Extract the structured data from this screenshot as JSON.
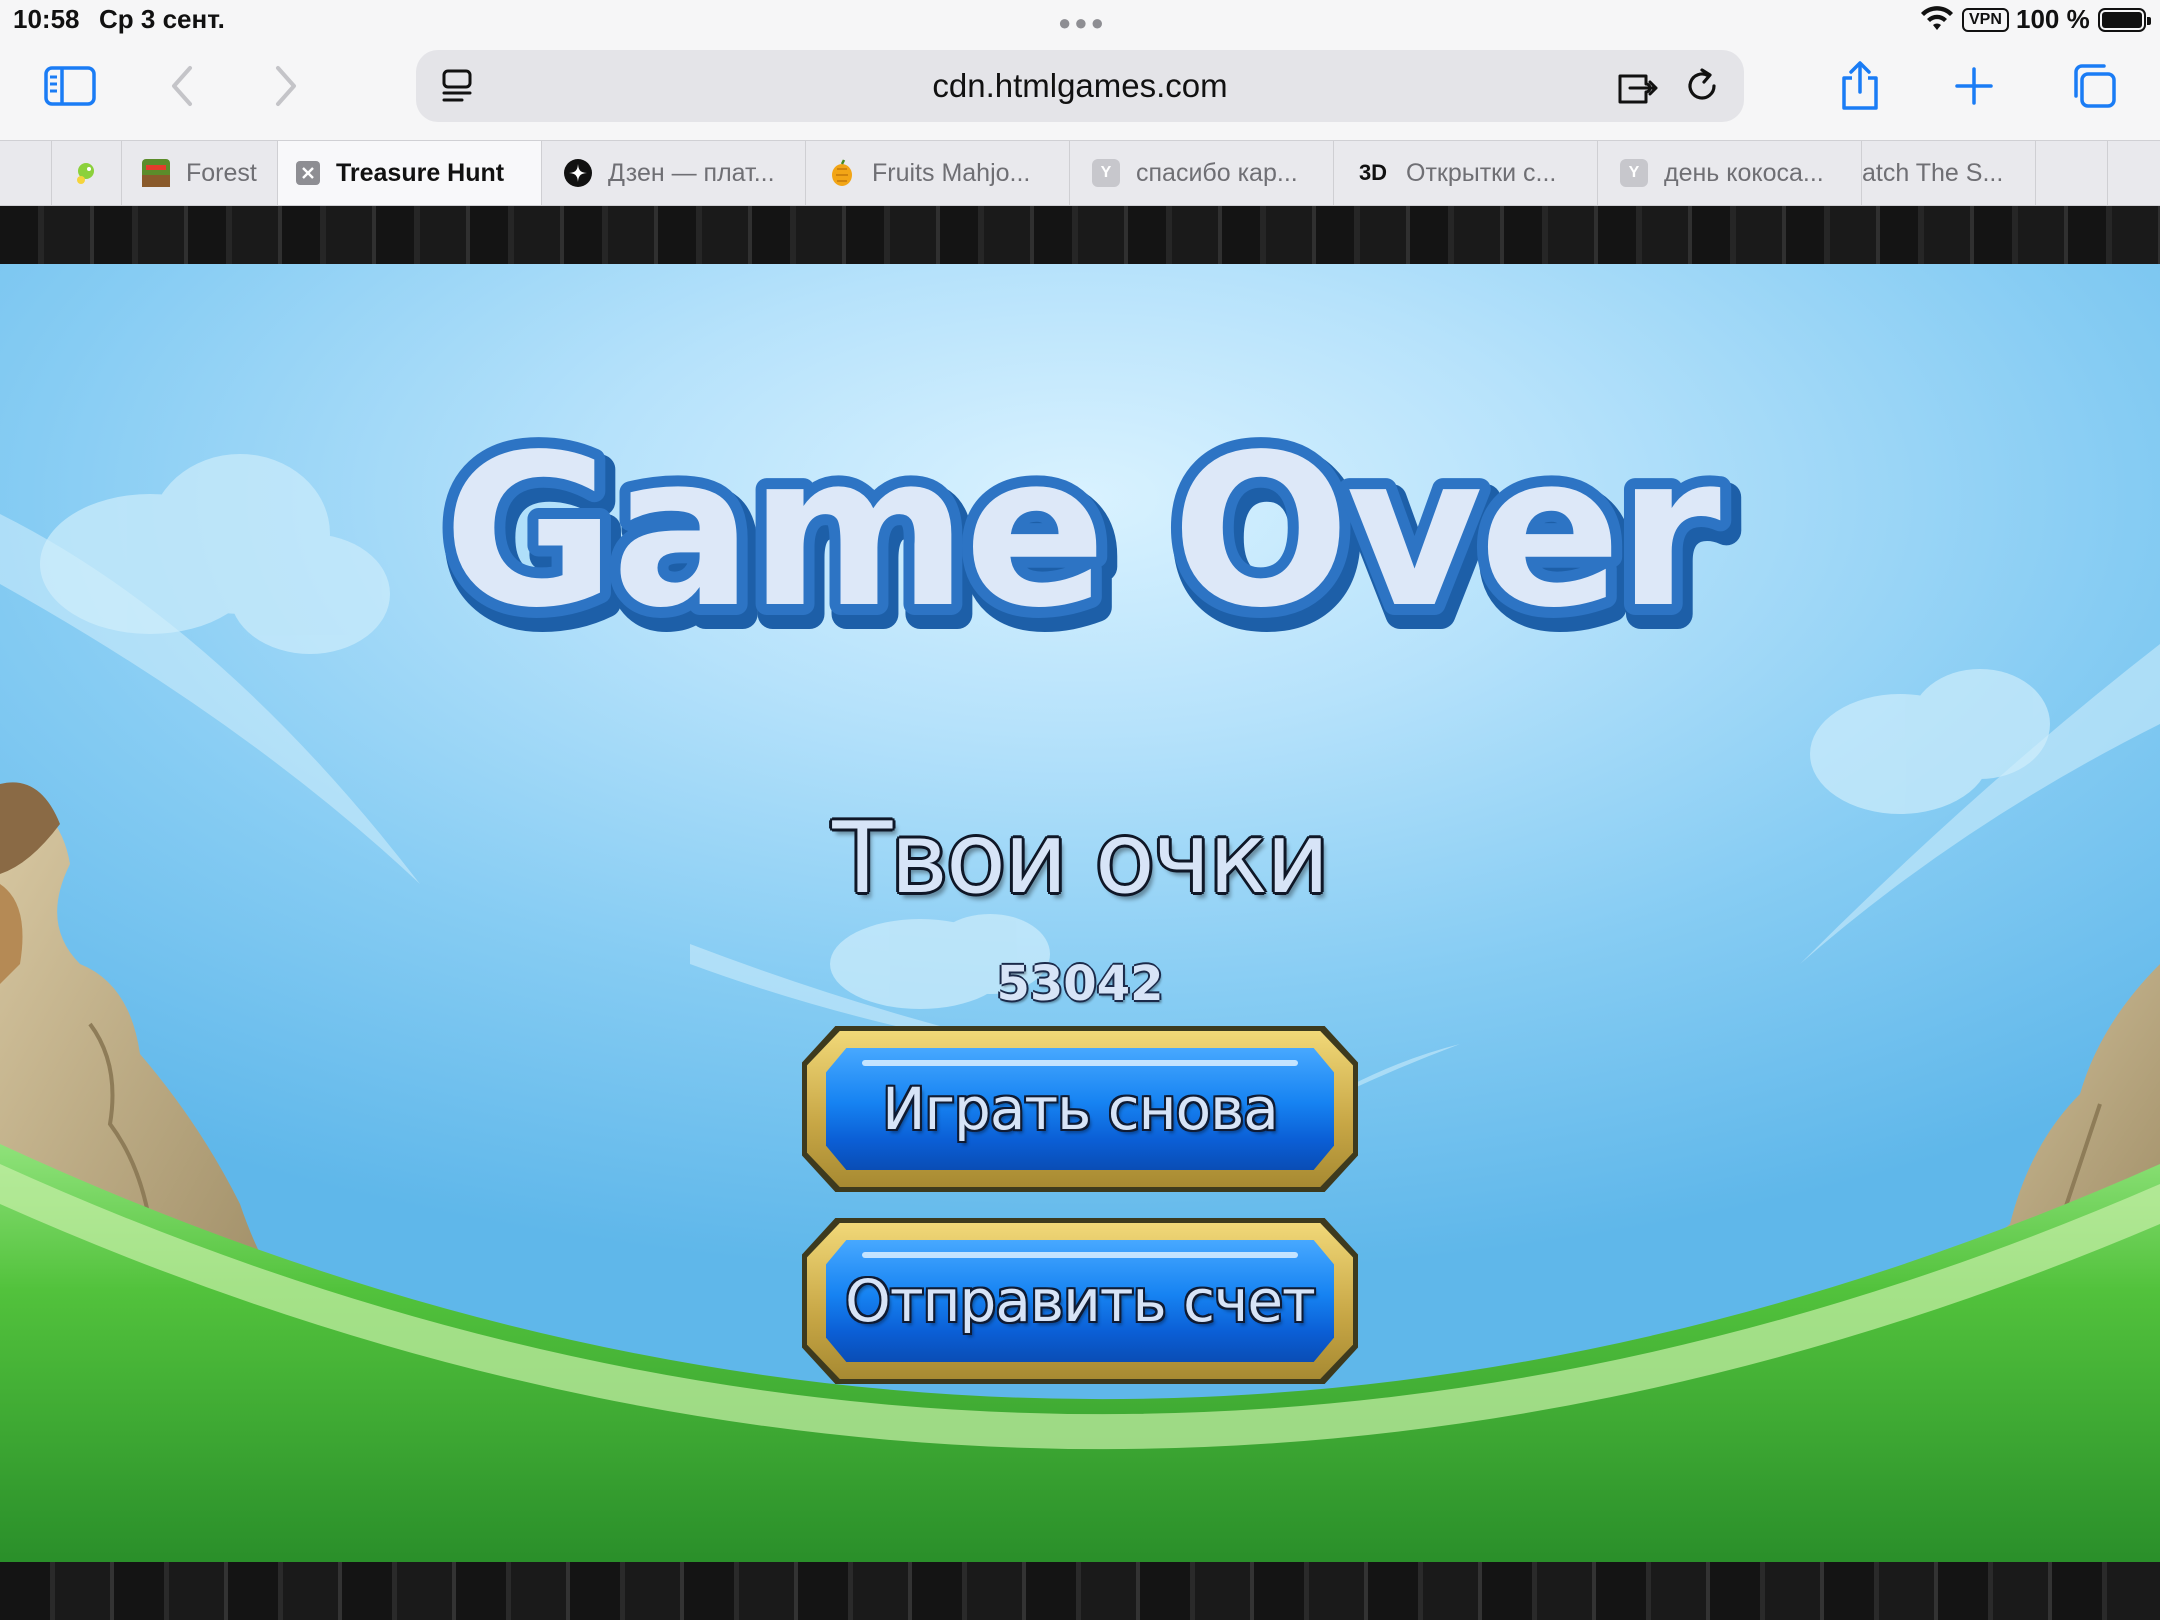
{
  "status_bar": {
    "time": "10:58",
    "date": "Ср 3 сент.",
    "vpn": "VPN",
    "battery": "100 %"
  },
  "toolbar": {
    "url": "cdn.htmlgames.com",
    "icons": [
      "sidebar-icon",
      "back-icon",
      "forward-icon",
      "page-menu-icon",
      "extension-icon",
      "reload-icon",
      "share-icon",
      "new-tab-icon",
      "tabs-overview-icon"
    ]
  },
  "tabs": [
    {
      "title": "",
      "favicon": "green-creature",
      "color": "#7cc242"
    },
    {
      "title": "Forest",
      "favicon": "game-thumb",
      "color": "#8a5a2b"
    },
    {
      "title": "Treasure Hunt",
      "favicon": "close",
      "color": "#8e8e93",
      "active": true
    },
    {
      "title": "Дзен — плат...",
      "favicon": "dzen",
      "color": "#111111"
    },
    {
      "title": "Fruits Mahjo...",
      "favicon": "fruit",
      "color": "#f2a516"
    },
    {
      "title": "спасибо кар...",
      "favicon": "Y",
      "color": "#c7c7cc"
    },
    {
      "title": "Открытки с...",
      "favicon": "3D",
      "color": "#e43b2c"
    },
    {
      "title": "день кокоса...",
      "favicon": "Y",
      "color": "#c7c7cc"
    },
    {
      "title": "atch The S...",
      "favicon": "",
      "color": ""
    },
    {
      "title": "",
      "favicon": "",
      "color": ""
    }
  ],
  "game": {
    "title": "Game Over",
    "score_label": "Твои очки",
    "score_value": "53042",
    "play_again": "Играть снова",
    "submit_score": "Отправить счет"
  }
}
